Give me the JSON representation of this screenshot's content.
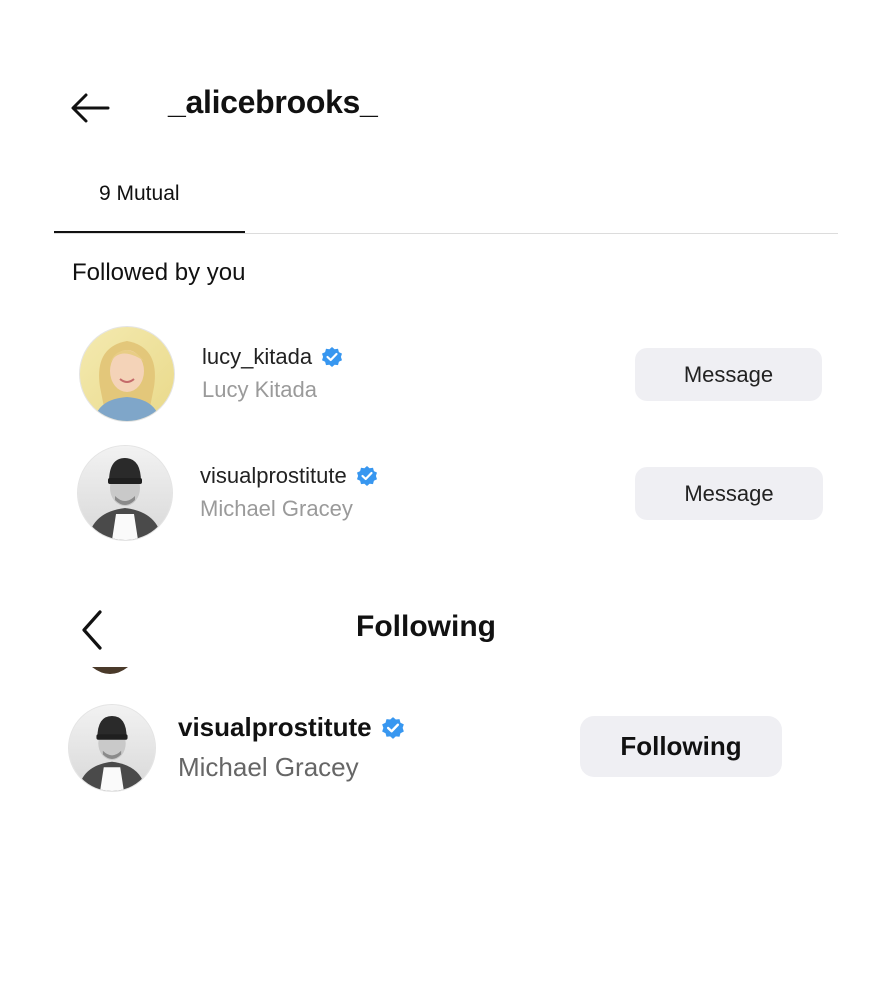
{
  "header": {
    "back_icon": "arrow-left-icon",
    "title": "_alicebrooks_"
  },
  "tabs": [
    {
      "label": "9 Mutual",
      "active": true
    }
  ],
  "section": {
    "title": "Followed by you"
  },
  "mutual_list": [
    {
      "username": "lucy_kitada",
      "full_name": "Lucy Kitada",
      "verified": true,
      "button": "Message",
      "avatar": "blonde-woman-portrait"
    },
    {
      "username": "visualprostitute",
      "full_name": "Michael Gracey",
      "verified": true,
      "button": "Message",
      "avatar": "man-beanie-portrait"
    }
  ],
  "following_panel": {
    "back_icon": "chevron-left-icon",
    "title": "Following",
    "item": {
      "username": "visualprostitute",
      "full_name": "Michael Gracey",
      "verified": true,
      "button": "Following",
      "avatar": "man-beanie-portrait"
    }
  },
  "colors": {
    "verified_badge": "#3897f0",
    "button_bg": "#efeff3",
    "secondary_text": "#9a9a9a"
  }
}
